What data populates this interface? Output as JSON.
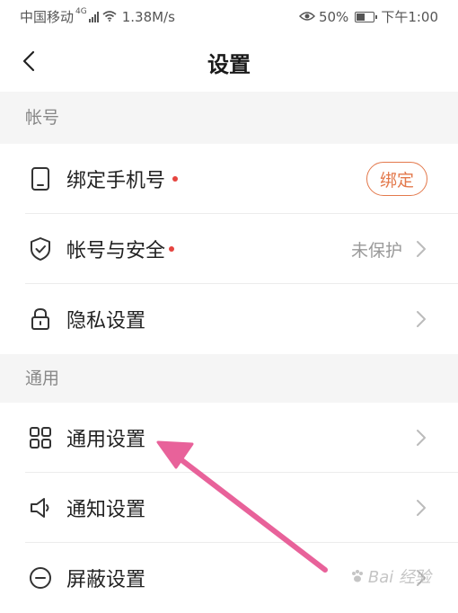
{
  "status_bar": {
    "carrier": "中国移动",
    "network": "4G",
    "speed": "1.38M/s",
    "battery_percent": "50%",
    "time": "下午1:00"
  },
  "nav": {
    "title": "设置"
  },
  "sections": {
    "account": {
      "header": "帐号",
      "items": [
        {
          "label": "绑定手机号",
          "icon": "phone-icon",
          "badge_dot": true,
          "action_label": "绑定"
        },
        {
          "label": "帐号与安全",
          "icon": "shield-check-icon",
          "badge_dot": true,
          "status": "未保护"
        },
        {
          "label": "隐私设置",
          "icon": "lock-icon",
          "badge_dot": false
        }
      ]
    },
    "general": {
      "header": "通用",
      "items": [
        {
          "label": "通用设置",
          "icon": "grid-icon"
        },
        {
          "label": "通知设置",
          "icon": "speaker-icon"
        },
        {
          "label": "屏蔽设置",
          "icon": "minus-circle-icon"
        }
      ]
    }
  },
  "watermark": {
    "text": "Bai 经验"
  },
  "colors": {
    "accent": "#e3794c",
    "dot": "#e64540",
    "arrow": "#e8629a",
    "section_bg": "#f5f5f5",
    "secondary_text": "#999999"
  }
}
